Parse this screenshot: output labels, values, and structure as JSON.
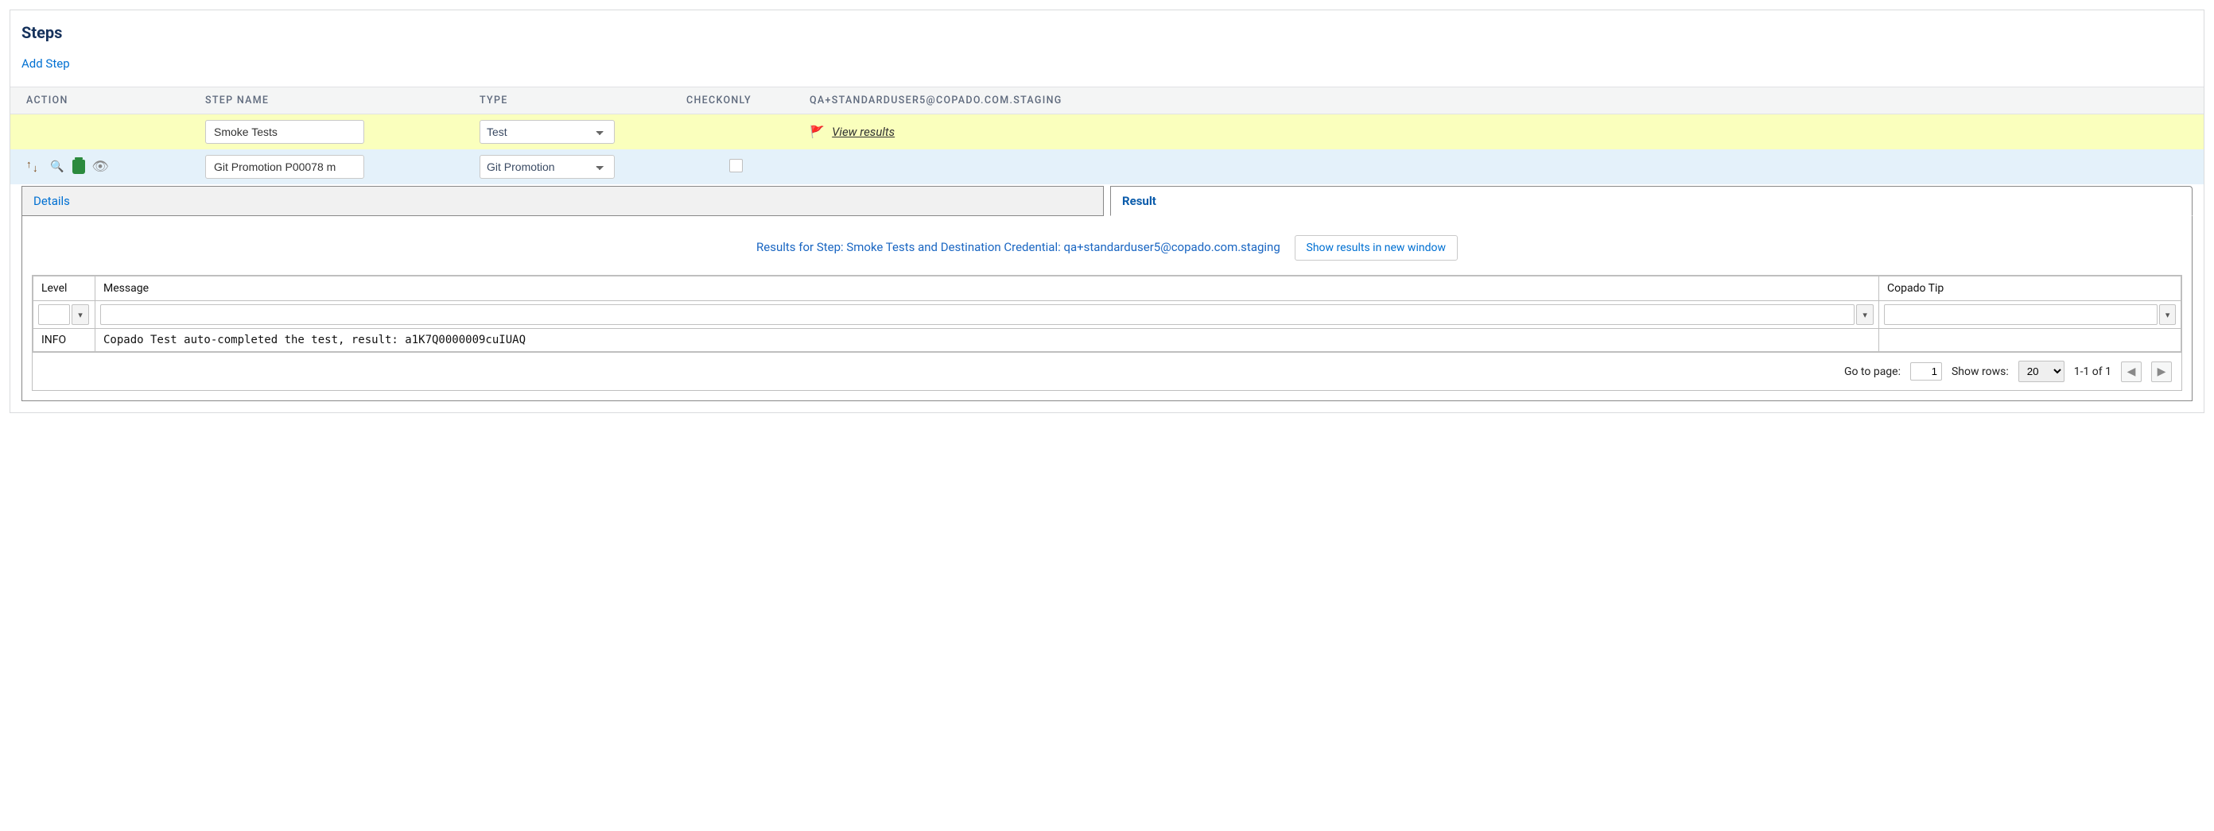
{
  "section_title": "Steps",
  "add_step_label": "Add Step",
  "columns": {
    "action": "ACTION",
    "step_name": "STEP NAME",
    "type": "TYPE",
    "checkonly": "CHECKONLY",
    "user_col": "QA+STANDARDUSER5@COPADO.COM.STAGING"
  },
  "rows": [
    {
      "name_value": "Smoke Tests",
      "type_value": "Test",
      "view_results_label": "View results",
      "view_results_icon": "flag-icon"
    },
    {
      "name_value": "Git Promotion P00078 m",
      "type_value": "Git Promotion",
      "checkonly_checked": false
    }
  ],
  "tabs": {
    "details": "Details",
    "result": "Result",
    "active": "result"
  },
  "result_panel": {
    "header": "Results for Step: Smoke Tests and Destination Credential: qa+standarduser5@copado.com.staging",
    "show_new_window_label": "Show results in new window",
    "grid_cols": {
      "level": "Level",
      "message": "Message",
      "tip": "Copado Tip"
    },
    "grid_rows": [
      {
        "level": "INFO",
        "message": "Copado Test auto-completed the test, result: a1K7Q0000009cuIUAQ",
        "tip": ""
      }
    ],
    "pager": {
      "goto_label": "Go to page:",
      "page_value": "1",
      "rows_label": "Show rows:",
      "rows_value": "20",
      "range": "1-1 of 1"
    }
  }
}
